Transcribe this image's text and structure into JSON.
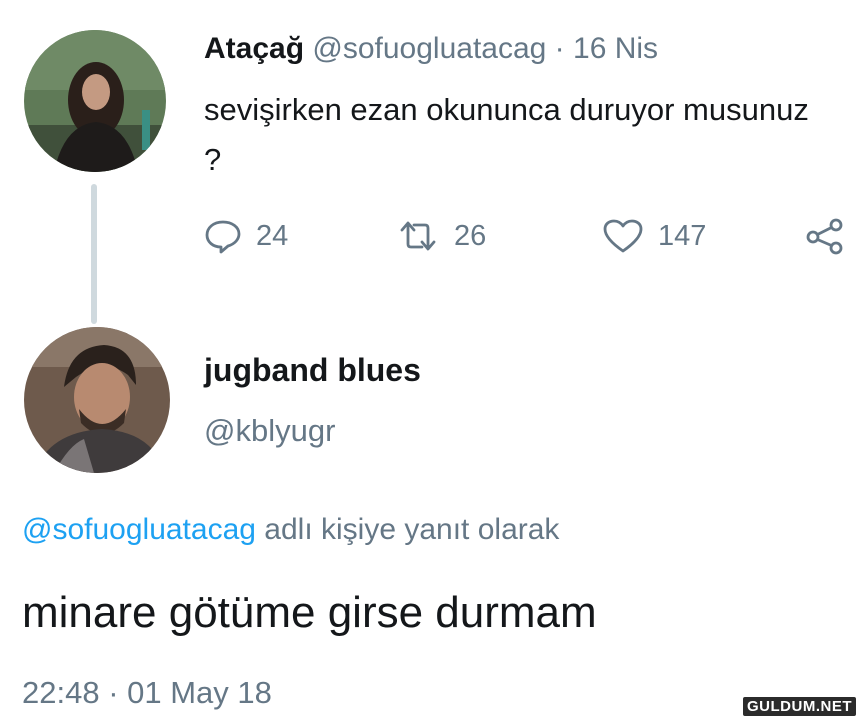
{
  "tweet": {
    "author_name": "Ataçağ",
    "author_handle": "@sofuogluatacag",
    "separator": " · ",
    "date": "16 Nis",
    "text": "sevişirken ezan okununca duruyor musunuz ?",
    "actions": {
      "replies": "24",
      "retweets": "26",
      "likes": "147"
    }
  },
  "reply": {
    "author_name": "jugband blues",
    "author_handle": "@kblyugr",
    "replying_to_handle": "@sofuogluatacag",
    "replying_to_suffix": " adlı kişiye yanıt olarak",
    "text": "minare götüme girse durmam",
    "timestamp": "22:48 · 01 May 18"
  },
  "watermark": "GULDUM.NET",
  "colors": {
    "link": "#1da1f2",
    "muted": "#657786",
    "text": "#14171a",
    "thread_line": "#cfd9de"
  },
  "icons": {
    "reply": "speech-bubble-icon",
    "retweet": "retweet-arrows-icon",
    "like": "heart-icon",
    "share": "share-icon"
  }
}
